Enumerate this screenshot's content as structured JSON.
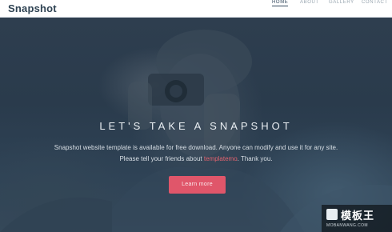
{
  "header": {
    "logo": "Snapshot",
    "nav": [
      {
        "label": "HOME",
        "active": true
      },
      {
        "label": "ABOUT",
        "active": false
      },
      {
        "label": "GALLERY",
        "active": false
      },
      {
        "label": "CONTACT",
        "active": false
      }
    ]
  },
  "hero": {
    "title": "LET'S TAKE A SNAPSHOT",
    "line1": "Snapshot website template is available for free download. Anyone can modify and use it for any site.",
    "line2_before": "Please tell your friends about ",
    "line2_link": "templatemo",
    "line2_after": ". Thank you.",
    "button": "Learn more"
  },
  "watermark": {
    "title": "模板王",
    "sub": "MOBANWANG.COM"
  },
  "colors": {
    "accent": "#e0566a",
    "link": "#e2636f",
    "header_bg": "#ffffff",
    "hero_bg": "#2b3c4d"
  }
}
